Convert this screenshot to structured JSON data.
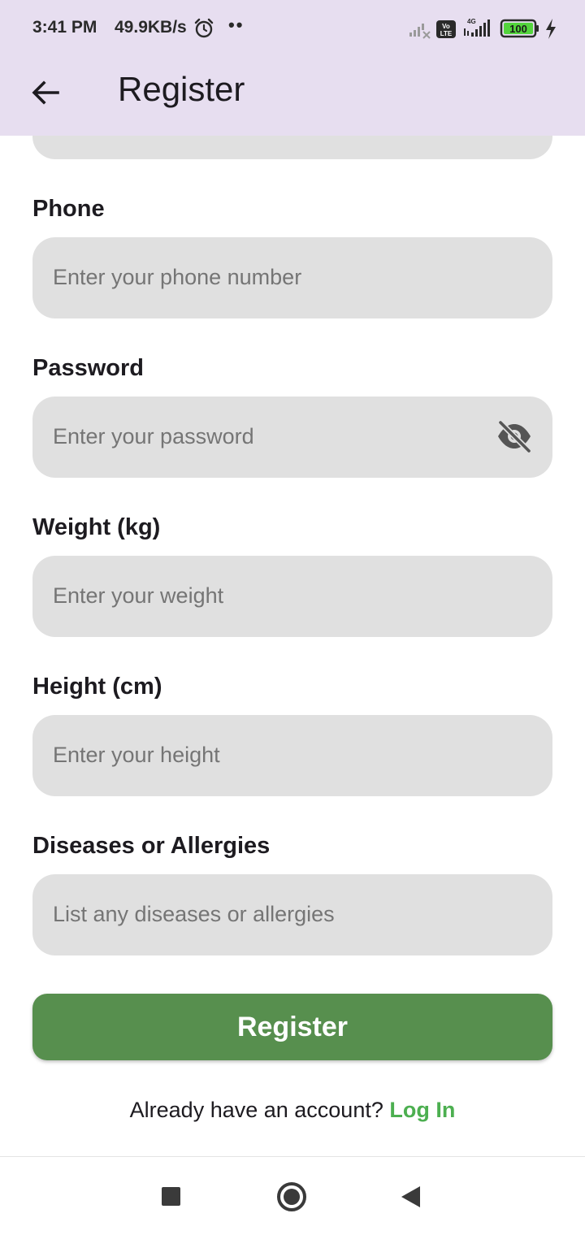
{
  "status_bar": {
    "time": "3:41 PM",
    "speed": "49.9KB/s",
    "dots": "••",
    "network": "4G",
    "battery": "100",
    "icons": [
      "alarm-icon",
      "signal-off-icon",
      "volte-icon",
      "signal-icon",
      "battery-icon",
      "charging-icon"
    ]
  },
  "app_bar": {
    "title": "Register",
    "back_icon": "arrow-back-icon"
  },
  "form": {
    "fields": [
      {
        "label": "Phone",
        "placeholder": "Enter your phone number"
      },
      {
        "label": "Password",
        "placeholder": "Enter your password",
        "icon": "visibility-off-icon"
      },
      {
        "label": "Weight (kg)",
        "placeholder": "Enter your weight"
      },
      {
        "label": "Height (cm)",
        "placeholder": "Enter your height"
      },
      {
        "label": "Diseases or Allergies",
        "placeholder": "List any diseases or allergies"
      }
    ],
    "submit_label": "Register"
  },
  "login_prompt": {
    "text": "Already have an account?",
    "link": "Log In"
  },
  "colors": {
    "app_bar_bg": "#e7def0",
    "field_bg": "#e0e0e0",
    "primary_button": "#578f4e",
    "link": "#4caf50"
  },
  "nav_bar": {
    "icons": [
      "recents-square-icon",
      "home-circle-icon",
      "back-triangle-icon"
    ]
  }
}
